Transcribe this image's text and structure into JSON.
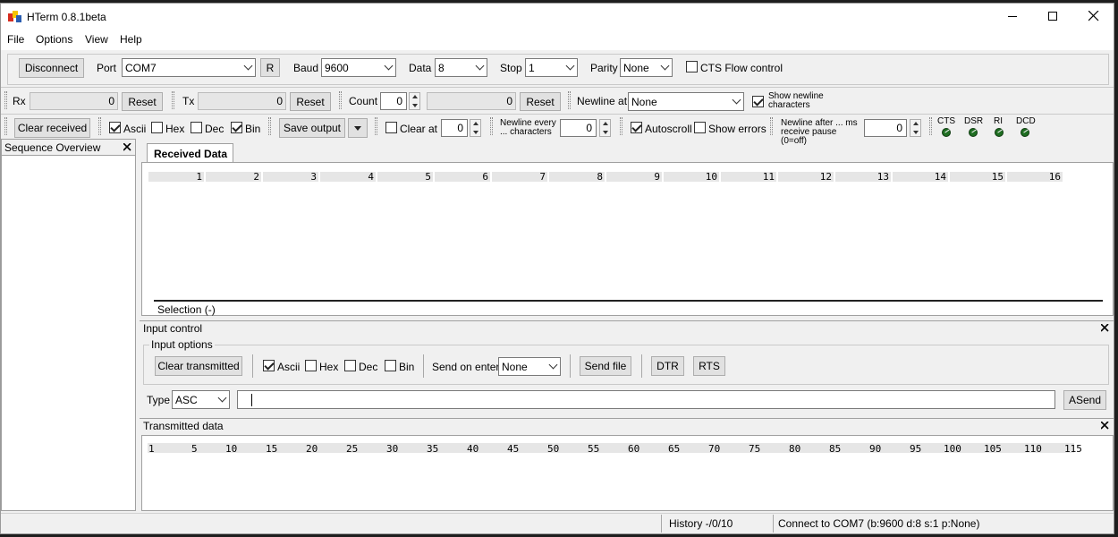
{
  "window": {
    "title": "HTerm 0.8.1beta"
  },
  "menu": [
    "File",
    "Options",
    "View",
    "Help"
  ],
  "connection": {
    "disconnect_label": "Disconnect",
    "port_label": "Port",
    "port_value": "COM7",
    "r_label": "R",
    "baud_label": "Baud",
    "baud_value": "9600",
    "data_label": "Data",
    "data_value": "8",
    "stop_label": "Stop",
    "stop_value": "1",
    "parity_label": "Parity",
    "parity_value": "None",
    "cts_flow_label": "CTS Flow control"
  },
  "counters": {
    "rx_label": "Rx",
    "rx_value": "0",
    "rx_reset": "Reset",
    "tx_label": "Tx",
    "tx_value": "0",
    "tx_reset": "Reset",
    "count_label": "Count",
    "count_value": "0",
    "count_display": "0",
    "count_reset": "Reset",
    "newline_at_label": "Newline at",
    "newline_at_value": "None",
    "show_newline_label": "Show newline characters"
  },
  "receive_toolbar": {
    "clear_received": "Clear received",
    "ascii": "Ascii",
    "hex": "Hex",
    "dec": "Dec",
    "bin": "Bin",
    "save_output": "Save output",
    "clear_at": "Clear at",
    "clear_at_value": "0",
    "newline_every": "Newline every ... characters",
    "newline_every_value": "0",
    "autoscroll": "Autoscroll",
    "show_errors": "Show errors",
    "newline_after": "Newline after ... ms receive pause (0=off)",
    "newline_after_value": "0",
    "cts": "CTS",
    "dsr": "DSR",
    "ri": "RI",
    "dcd": "DCD"
  },
  "sequence_overview": {
    "title": "Sequence Overview"
  },
  "received": {
    "tab_label": "Received Data",
    "columns": [
      "1",
      "2",
      "3",
      "4",
      "5",
      "6",
      "7",
      "8",
      "9",
      "10",
      "11",
      "12",
      "13",
      "14",
      "15",
      "16"
    ],
    "selection": "Selection (-)"
  },
  "input_control": {
    "title": "Input control",
    "options_label": "Input options",
    "clear_transmitted": "Clear transmitted",
    "ascii": "Ascii",
    "hex": "Hex",
    "dec": "Dec",
    "bin": "Bin",
    "send_on_enter_label": "Send on enter",
    "send_on_enter_value": "None",
    "send_file": "Send file",
    "dtr": "DTR",
    "rts": "RTS",
    "type_label": "Type",
    "type_value": "ASC",
    "input_value": "",
    "asend": "ASend"
  },
  "transmitted": {
    "title": "Transmitted data",
    "columns": [
      "1",
      "5",
      "10",
      "15",
      "20",
      "25",
      "30",
      "35",
      "40",
      "45",
      "50",
      "55",
      "60",
      "65",
      "70",
      "75",
      "80",
      "85",
      "90",
      "95",
      "100",
      "105",
      "110",
      "115"
    ]
  },
  "status": {
    "history": "History -/0/10",
    "connection": "Connect to COM7 (b:9600 d:8 s:1 p:None)"
  },
  "colors": {
    "led": "#1f6e22",
    "window_bg": "#f0f0f0",
    "titlebar": "#ffffff"
  }
}
